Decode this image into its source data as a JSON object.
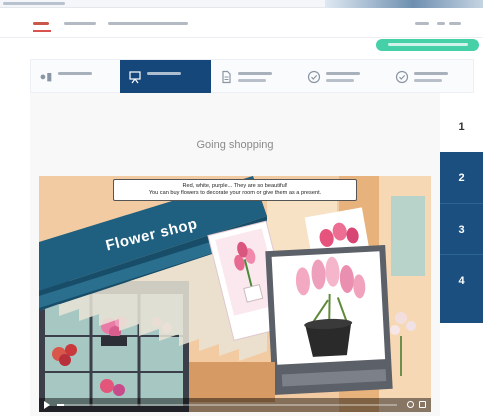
{
  "lesson": {
    "title": "Going shopping"
  },
  "pager": {
    "pages": [
      "1",
      "2",
      "3",
      "4"
    ],
    "current": "1"
  },
  "video": {
    "caption_line1": "Red, white, purple... They are so beautiful!",
    "caption_line2": "You can buy flowers to decorate your room or give them as a present.",
    "sign_text": "Flower shop",
    "progress": 0.02
  },
  "icons": {
    "step_1": "volume-icon",
    "step_2": "presentation-icon",
    "step_3": "document-icon",
    "step_4": "check-circle-icon",
    "step_5": "check-circle-icon",
    "video_play": "play-icon",
    "video_fullscreen": "fullscreen-icon"
  },
  "colors": {
    "active_step": "#16477a",
    "pager_blue": "#1a4f7f",
    "accent_green": "#45d0a8",
    "active_tab_underline": "#d9534f"
  }
}
